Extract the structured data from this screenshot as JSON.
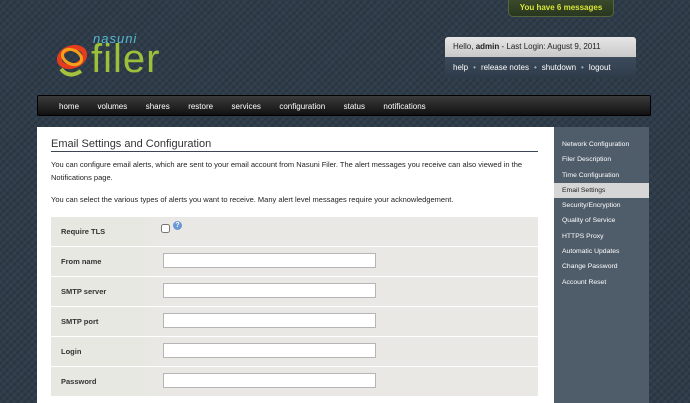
{
  "messages_tab": "You have 6 messages",
  "logo": {
    "small": "nasuni",
    "big": "filer"
  },
  "user": {
    "greeting_prefix": "Hello,",
    "username": "admin",
    "last_login": "- Last Login: August 9, 2011",
    "links": [
      "help",
      "release notes",
      "shutdown",
      "logout"
    ]
  },
  "nav": [
    "home",
    "volumes",
    "shares",
    "restore",
    "services",
    "configuration",
    "status",
    "notifications"
  ],
  "main": {
    "title": "Email Settings and Configuration",
    "intro1": "You can configure email alerts, which are sent to your email account from Nasuni Filer. The alert messages you receive can also viewed in the Notifications page.",
    "intro2": "You can select the various types of alerts you want to receive. Many alert level messages require your acknowledgement.",
    "form": {
      "require_tls": "Require TLS",
      "from_name": "From name",
      "smtp_server": "SMTP server",
      "smtp_port": "SMTP port",
      "login": "Login",
      "password": "Password"
    }
  },
  "sidebar": [
    "Network Configuration",
    "Filer Description",
    "Time Configuration",
    "Email Settings",
    "Security/Encryption",
    "Quality of Service",
    "HTTPS Proxy",
    "Automatic Updates",
    "Change Password",
    "Account Reset"
  ],
  "colors": {
    "accent_green": "#9cc03a",
    "msg_yellow": "#d8e636",
    "sidebar_bg": "#4f5c6a"
  }
}
